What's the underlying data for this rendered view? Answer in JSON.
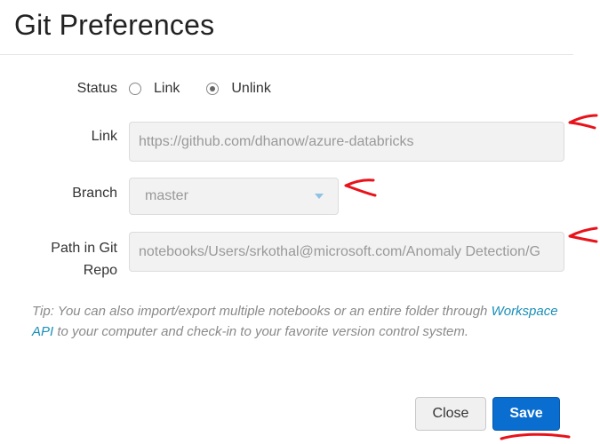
{
  "dialog": {
    "title": "Git Preferences"
  },
  "form": {
    "status": {
      "label": "Status",
      "options": [
        {
          "label": "Link",
          "checked": false
        },
        {
          "label": "Unlink",
          "checked": true
        }
      ]
    },
    "link": {
      "label": "Link",
      "value": "https://github.com/dhanow/azure-databricks"
    },
    "branch": {
      "label": "Branch",
      "value": "master"
    },
    "path": {
      "label_line1": "Path in Git",
      "label_line2": "Repo",
      "value": "notebooks/Users/srkothal@microsoft.com/Anomaly Detection/G"
    }
  },
  "tip": {
    "prefix": "Tip: You can also import/export multiple notebooks or an entire folder through ",
    "link_text": "Workspace API",
    "suffix": " to your computer and check-in to your favorite version control system."
  },
  "buttons": {
    "close_label": "Close",
    "save_label": "Save"
  },
  "colors": {
    "primary": "#0a6ed1",
    "link": "#1a8fb8",
    "annotation": "#e8121b"
  }
}
